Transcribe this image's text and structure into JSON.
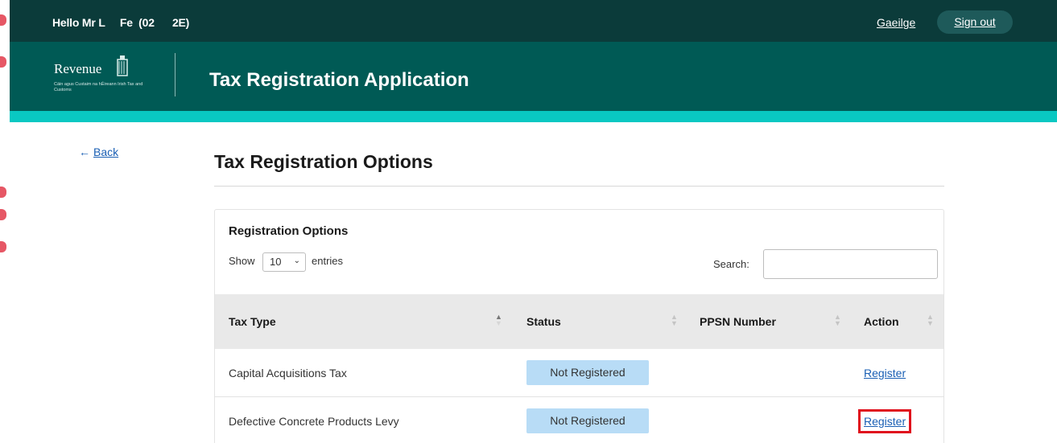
{
  "topbar": {
    "greeting": "Hello Mr L     Fe  (02      2E)",
    "language_link": "Gaeilge",
    "sign_out": "Sign out"
  },
  "header": {
    "logo_text": "Revenue",
    "logo_subtext": "Cáin agus Custaim na hÉireann Irish Tax and Customs",
    "app_title": "Tax Registration Application"
  },
  "nav": {
    "back_arrow": "←",
    "back_label": "Back"
  },
  "page": {
    "title": "Tax Registration Options"
  },
  "options_card": {
    "title": "Registration Options",
    "show_label": "Show",
    "entries_selected": "10",
    "entries_label": "entries",
    "search_label": "Search:",
    "search_value": ""
  },
  "table": {
    "columns": [
      "Tax Type",
      "Status",
      "PPSN Number",
      "Action"
    ],
    "rows": [
      {
        "tax_type": "Capital Acquisitions Tax",
        "status": "Not Registered",
        "ppsn": "",
        "action": "Register"
      },
      {
        "tax_type": "Defective Concrete Products Levy",
        "status": "Not Registered",
        "ppsn": "",
        "action": "Register"
      }
    ]
  },
  "colors": {
    "topbar": "#0b3b3a",
    "header": "#005a55",
    "accent": "#09c8c2",
    "link": "#1a5fb4",
    "status_badge": "#b8dcf6",
    "highlight": "#e0101d"
  },
  "icons": {
    "back": "arrow-left-icon",
    "select": "chevron-down-icon",
    "sort": "sort-icon",
    "logo": "harp-icon"
  }
}
